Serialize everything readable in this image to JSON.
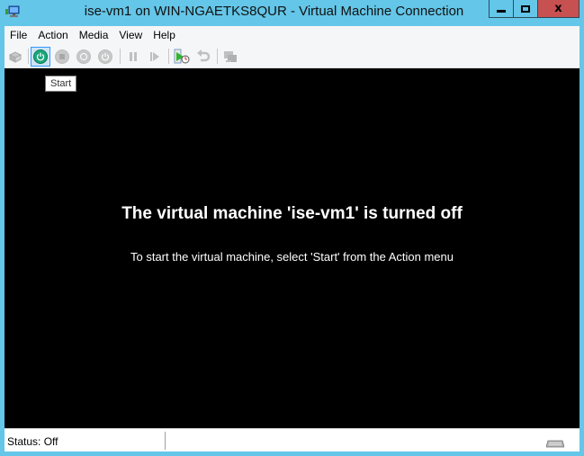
{
  "window": {
    "title": "ise-vm1 on WIN-NGAETKS8QUR - Virtual Machine Connection",
    "controls": {
      "minimize": "minimize",
      "maximize": "maximize",
      "close": "x"
    }
  },
  "menubar": {
    "items": [
      {
        "label": "File"
      },
      {
        "label": "Action"
      },
      {
        "label": "Media"
      },
      {
        "label": "View"
      },
      {
        "label": "Help"
      }
    ]
  },
  "toolbar": {
    "buttons": [
      {
        "name": "ctrl-alt-del",
        "icon": "ctrl-alt-del-icon",
        "enabled": false
      },
      {
        "name": "start",
        "icon": "power-icon",
        "enabled": true,
        "active": true
      },
      {
        "name": "turn-off",
        "icon": "stop-icon",
        "enabled": false
      },
      {
        "name": "shut-down",
        "icon": "shutdown-icon",
        "enabled": false
      },
      {
        "name": "save",
        "icon": "save-state-icon",
        "enabled": false
      },
      {
        "name": "pause",
        "icon": "pause-icon",
        "enabled": false
      },
      {
        "name": "resume",
        "icon": "resume-icon",
        "enabled": false
      },
      {
        "name": "checkpoint",
        "icon": "checkpoint-icon",
        "enabled": true
      },
      {
        "name": "revert",
        "icon": "revert-icon",
        "enabled": false
      },
      {
        "name": "enhanced-session",
        "icon": "enhanced-session-icon",
        "enabled": false
      }
    ],
    "tooltip": "Start"
  },
  "screen": {
    "headline": "The virtual machine 'ise-vm1' is turned off",
    "instruction": "To start the virtual machine, select 'Start' from the Action menu"
  },
  "statusbar": {
    "status": "Status: Off",
    "keyboard_icon": "keyboard-icon"
  },
  "colors": {
    "frame": "#64c6e8",
    "close_button": "#c75050",
    "start_green": "#1aa87a",
    "screen_bg": "#000000"
  }
}
